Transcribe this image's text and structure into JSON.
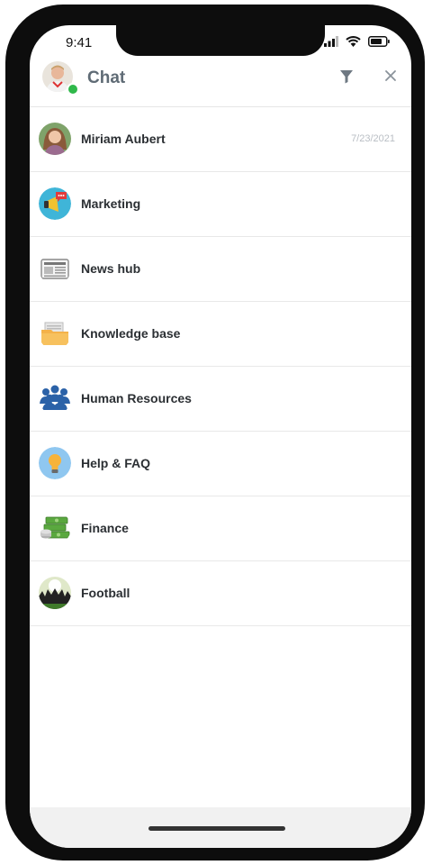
{
  "status_bar": {
    "time": "9:41"
  },
  "header": {
    "title": "Chat"
  },
  "chats": [
    {
      "name": "Miriam Aubert",
      "date": "7/23/2021",
      "icon": "person-photo-icon"
    },
    {
      "name": "Marketing",
      "icon": "megaphone-icon"
    },
    {
      "name": "News hub",
      "icon": "newspaper-icon"
    },
    {
      "name": "Knowledge base",
      "icon": "folder-icon"
    },
    {
      "name": "Human Resources",
      "icon": "people-group-icon"
    },
    {
      "name": "Help & FAQ",
      "icon": "lightbulb-icon"
    },
    {
      "name": "Finance",
      "icon": "money-stack-icon"
    },
    {
      "name": "Football",
      "icon": "football-crowd-icon"
    }
  ],
  "colors": {
    "presence": "#2fb84a",
    "title": "#5f6b75",
    "date": "#b9bec4"
  }
}
